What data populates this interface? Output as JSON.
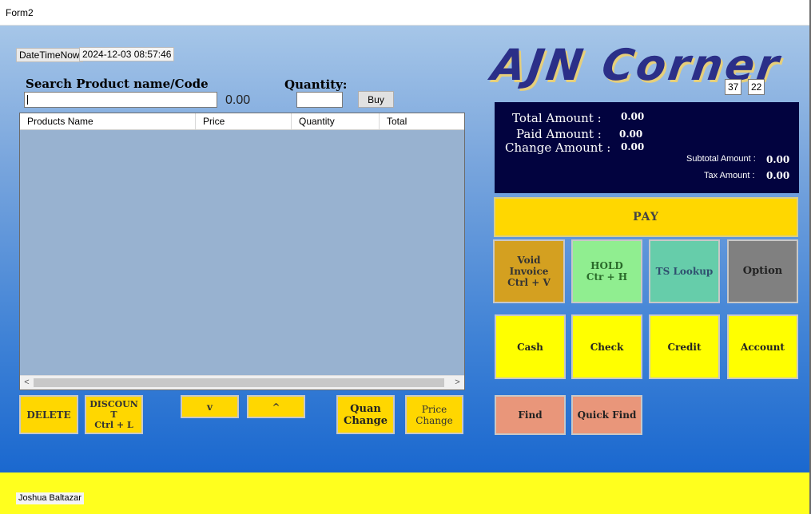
{
  "window": {
    "title": "Form2"
  },
  "datetime": {
    "label": "DateTimeNow",
    "value": "2024-12-03 08:57:46"
  },
  "search": {
    "title": "Search Product name/Code",
    "value": "",
    "amount": "0.00"
  },
  "quantity": {
    "title": "Quantity:",
    "value": "",
    "buy_label": "Buy"
  },
  "grid": {
    "columns": [
      "Products Name",
      "Price",
      "Quantity",
      "Total"
    ],
    "rows": []
  },
  "scrollbar": {
    "left_arrow": "<",
    "right_arrow": ">"
  },
  "actions": {
    "delete": "DELETE",
    "discount_line1": "DISCOUN",
    "discount_line2": "T",
    "discount_line3": "Ctrl + L",
    "down": "v",
    "up": "^",
    "quan_change_line1": "Quan",
    "quan_change_line2": "Change",
    "price_change_line1": "Price",
    "price_change_line2": "Change"
  },
  "logo": {
    "text": "AJN Corner"
  },
  "counters": {
    "a": "37",
    "b": "22"
  },
  "totals": {
    "total_label": "Total Amount :",
    "total_value": "0.00",
    "paid_label": "Paid Amount :",
    "paid_value": "0.00",
    "change_label": "Change Amount :",
    "change_value": "0.00",
    "subtotal_label": "Subtotal Amount :",
    "subtotal_value": "0.00",
    "tax_label": "Tax Amount :",
    "tax_value": "0.00"
  },
  "pay": {
    "label": "PAY"
  },
  "functions": {
    "void_line1": "Void",
    "void_line2": "Invoice",
    "void_line3": "Ctrl + V",
    "hold_line1": "HOLD",
    "hold_line2": "Ctr + H",
    "lookup": "TS Lookup",
    "option": "Option"
  },
  "payment_methods": {
    "cash": "Cash",
    "check": "Check",
    "credit": "Credit",
    "account": "Account"
  },
  "find": {
    "find": "Find",
    "quick_find": "Quick Find"
  },
  "footer": {
    "user": "Joshua Baltazar"
  },
  "colors": {
    "yellow_button": "#ffd700",
    "payment_button": "#ffff00",
    "void": "#d4a020",
    "hold": "#90ee90",
    "lookup": "#66cdaa",
    "option": "#808080",
    "find": "#e9967a",
    "totals_panel": "#02033f",
    "footer": "#ffff1e"
  }
}
